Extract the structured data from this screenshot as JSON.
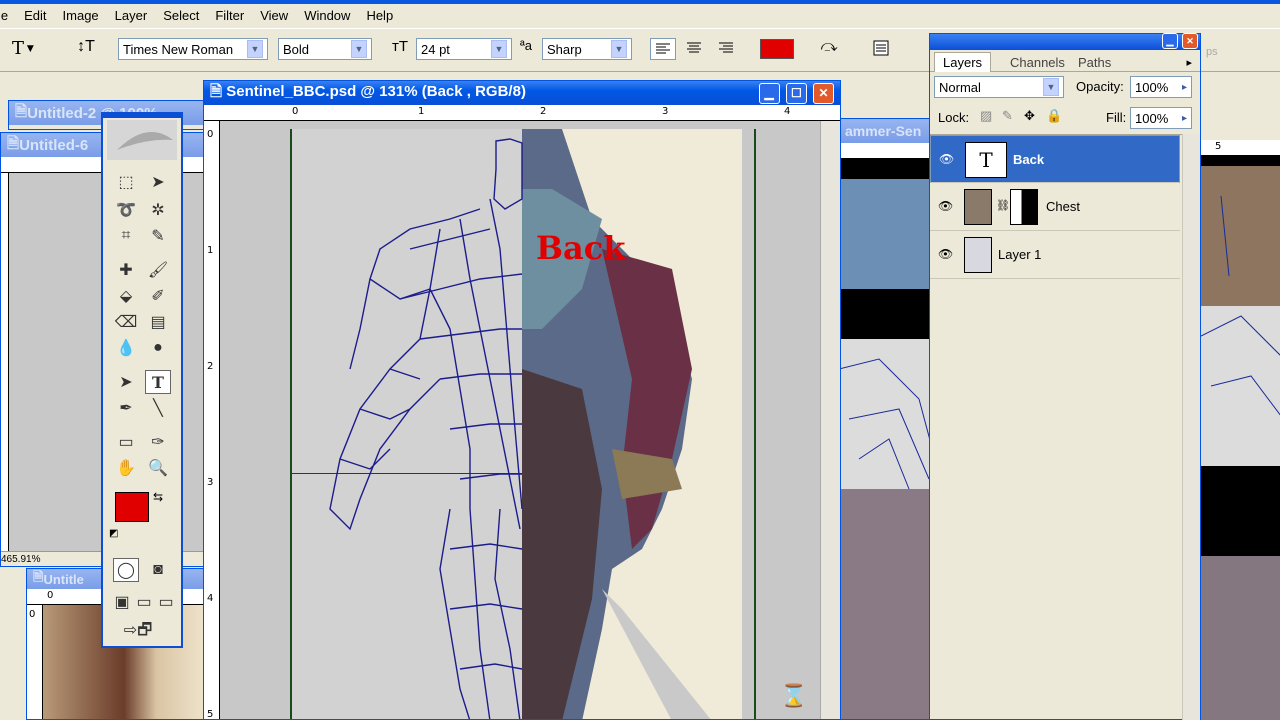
{
  "menu": {
    "items": [
      "le",
      "Edit",
      "Image",
      "Layer",
      "Select",
      "Filter",
      "View",
      "Window",
      "Help"
    ]
  },
  "options": {
    "tool_glyph": "T",
    "font_family": "Times New Roman",
    "font_style": "Bold",
    "font_size": "24 pt",
    "antialias": "Sharp",
    "text_color": "#e00000"
  },
  "document": {
    "title": "Sentinel_BBC.psd @ 131% (Back , RGB/8)",
    "ruler_h": [
      "0",
      "1",
      "2",
      "3",
      "4"
    ],
    "ruler_v": [
      "0",
      "1",
      "2",
      "3",
      "4",
      "5"
    ],
    "canvas_text": "Back"
  },
  "bg_windows": {
    "untitled2": "Untitled-2 @ 100%",
    "untitled6": "Untitled-6",
    "untitled_lower": "Untitle",
    "hammer": "ammer-Sen",
    "zoom_readout": "465.91%"
  },
  "layers_panel": {
    "tabs": [
      "Layers",
      "Channels",
      "Paths"
    ],
    "blend_mode": "Normal",
    "opacity_label": "Opacity:",
    "opacity_value": "100%",
    "lock_label": "Lock:",
    "fill_label": "Fill:",
    "fill_value": "100%",
    "layers": [
      {
        "name": "Back",
        "selected": true
      },
      {
        "name": "Chest",
        "selected": false
      },
      {
        "name": "Layer 1",
        "selected": false
      }
    ],
    "right_stub": "ps"
  },
  "colors": {
    "foreground": "#e00000",
    "background": "#ffffff",
    "xp_blue": "#0054e3"
  },
  "icons": [
    "type-tool-icon",
    "marquee-icon",
    "move-icon",
    "lasso-icon",
    "magic-wand-icon",
    "crop-icon",
    "slice-icon",
    "healing-icon",
    "brush-icon",
    "stamp-icon",
    "history-brush-icon",
    "eraser-icon",
    "gradient-icon",
    "blur-icon",
    "dodge-icon",
    "path-select-icon",
    "pen-icon",
    "line-icon",
    "notes-icon",
    "eyedropper-icon",
    "hand-icon",
    "zoom-icon",
    "hourglass-icon",
    "eye-icon"
  ]
}
